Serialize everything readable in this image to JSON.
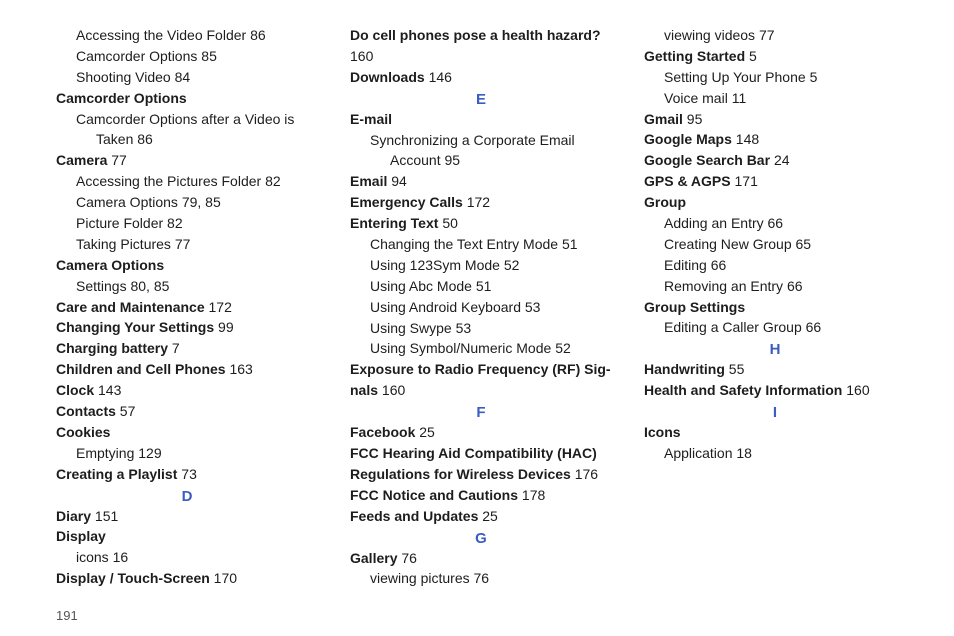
{
  "page_number": "191",
  "col1": [
    {
      "cls": "line in1",
      "label": "Accessing the Video Folder",
      "page": "86"
    },
    {
      "cls": "line in1",
      "label": "Camcorder Options",
      "page": "85"
    },
    {
      "cls": "line in1",
      "label": "Shooting Video",
      "page": "84"
    },
    {
      "cls": "line",
      "bold": true,
      "label": "Camcorder Options"
    },
    {
      "cls": "line in1",
      "label": "Camcorder Options after a Video is"
    },
    {
      "cls": "line in2",
      "label": "Taken",
      "page": "86"
    },
    {
      "cls": "line",
      "bold": true,
      "label": "Camera",
      "page": "77"
    },
    {
      "cls": "line in1",
      "label": "Accessing the Pictures Folder",
      "page": "82"
    },
    {
      "cls": "line in1",
      "label": "Camera Options",
      "page": "79, 85"
    },
    {
      "cls": "line in1",
      "label": "Picture Folder",
      "page": "82"
    },
    {
      "cls": "line in1",
      "label": "Taking Pictures",
      "page": "77"
    },
    {
      "cls": "line",
      "bold": true,
      "label": "Camera Options"
    },
    {
      "cls": "line in1",
      "label": "Settings",
      "page": "80, 85"
    },
    {
      "cls": "line",
      "bold": true,
      "label": "Care and Maintenance",
      "page": "172"
    },
    {
      "cls": "line",
      "bold": true,
      "label": "Changing Your Settings",
      "page": "99"
    },
    {
      "cls": "line",
      "bold": true,
      "label": "Charging battery",
      "page": "7"
    },
    {
      "cls": "line",
      "bold": true,
      "label": "Children and Cell Phones",
      "page": "163"
    },
    {
      "cls": "line",
      "bold": true,
      "label": "Clock",
      "page": "143"
    },
    {
      "cls": "line",
      "bold": true,
      "label": "Contacts",
      "page": "57"
    },
    {
      "cls": "line",
      "bold": true,
      "label": "Cookies"
    },
    {
      "cls": "line in1",
      "label": "Emptying",
      "page": "129"
    },
    {
      "cls": "line",
      "bold": true,
      "label": "Creating a Playlist",
      "page": "73"
    },
    {
      "cls": "letter",
      "label": "D"
    },
    {
      "cls": "line",
      "bold": true,
      "label": "Diary",
      "page": "151"
    },
    {
      "cls": "line",
      "bold": true,
      "label": "Display"
    }
  ],
  "col2": [
    {
      "cls": "line in1",
      "label": "icons",
      "page": "16"
    },
    {
      "cls": "line",
      "bold": true,
      "label": "Display / Touch-Screen",
      "page": "170"
    },
    {
      "cls": "line",
      "bold": true,
      "label": "Do cell phones pose a health hazard?"
    },
    {
      "cls": "line",
      "label": "160"
    },
    {
      "cls": "line",
      "bold": true,
      "label": "Downloads",
      "page": "146"
    },
    {
      "cls": "letter",
      "label": "E"
    },
    {
      "cls": "line",
      "bold": true,
      "label": "E-mail"
    },
    {
      "cls": "line in1",
      "label": "Synchronizing a Corporate Email"
    },
    {
      "cls": "line in2",
      "label": "Account",
      "page": "95"
    },
    {
      "cls": "line",
      "bold": true,
      "label": "Email",
      "page": "94"
    },
    {
      "cls": "line",
      "bold": true,
      "label": "Emergency Calls",
      "page": "172"
    },
    {
      "cls": "line",
      "bold": true,
      "label": "Entering Text",
      "page": "50"
    },
    {
      "cls": "line in1",
      "label": "Changing the Text Entry Mode",
      "page": "51"
    },
    {
      "cls": "line in1",
      "label": "Using 123Sym Mode",
      "page": "52"
    },
    {
      "cls": "line in1",
      "label": "Using Abc Mode",
      "page": "51"
    },
    {
      "cls": "line in1",
      "label": "Using Android Keyboard",
      "page": "53"
    },
    {
      "cls": "line in1",
      "label": "Using Swype",
      "page": "53"
    },
    {
      "cls": "line in1",
      "label": "Using Symbol/Numeric Mode",
      "page": "52"
    },
    {
      "cls": "line",
      "bold": true,
      "label": "Exposure to Radio Frequency (RF) Sig-"
    },
    {
      "cls": "line",
      "bold": true,
      "label": "nals",
      "page": "160"
    },
    {
      "cls": "letter",
      "label": "F"
    },
    {
      "cls": "line",
      "bold": true,
      "label": "Facebook",
      "page": "25"
    },
    {
      "cls": "line",
      "bold": true,
      "label": "FCC Hearing Aid Compatibility (HAC)"
    },
    {
      "cls": "line",
      "bold": true,
      "label": "Regulations for Wireless Devices",
      "page": "176"
    },
    {
      "cls": "line",
      "bold": true,
      "label": "FCC Notice and Cautions",
      "page": "178"
    }
  ],
  "col3": [
    {
      "cls": "line",
      "bold": true,
      "label": "Feeds and Updates",
      "page": "25"
    },
    {
      "cls": "letter",
      "label": "G"
    },
    {
      "cls": "line",
      "bold": true,
      "label": "Gallery",
      "page": "76"
    },
    {
      "cls": "line in1",
      "label": "viewing pictures",
      "page": "76"
    },
    {
      "cls": "line in1",
      "label": "viewing videos",
      "page": "77"
    },
    {
      "cls": "line",
      "bold": true,
      "label": "Getting Started",
      "page": "5"
    },
    {
      "cls": "line in1",
      "label": "Setting Up Your Phone",
      "page": "5"
    },
    {
      "cls": "line in1",
      "label": "Voice mail",
      "page": "11"
    },
    {
      "cls": "line",
      "bold": true,
      "label": "Gmail",
      "page": "95"
    },
    {
      "cls": "line",
      "bold": true,
      "label": "Google Maps",
      "page": "148"
    },
    {
      "cls": "line",
      "bold": true,
      "label": "Google Search Bar",
      "page": "24"
    },
    {
      "cls": "line",
      "bold": true,
      "label": "GPS & AGPS",
      "page": "171"
    },
    {
      "cls": "line",
      "bold": true,
      "label": "Group"
    },
    {
      "cls": "line in1",
      "label": "Adding an Entry",
      "page": "66"
    },
    {
      "cls": "line in1",
      "label": "Creating New Group",
      "page": "65"
    },
    {
      "cls": "line in1",
      "label": "Editing",
      "page": "66"
    },
    {
      "cls": "line in1",
      "label": "Removing an Entry",
      "page": "66"
    },
    {
      "cls": "line",
      "bold": true,
      "label": "Group Settings"
    },
    {
      "cls": "line in1",
      "label": "Editing a Caller Group",
      "page": "66"
    },
    {
      "cls": "letter",
      "label": "H"
    },
    {
      "cls": "line",
      "bold": true,
      "label": "Handwriting",
      "page": "55"
    },
    {
      "cls": "line",
      "bold": true,
      "label": "Health and Safety Information",
      "page": "160"
    },
    {
      "cls": "letter",
      "label": "I"
    },
    {
      "cls": "line",
      "bold": true,
      "label": "Icons"
    },
    {
      "cls": "line in1",
      "label": "Application",
      "page": "18"
    }
  ]
}
